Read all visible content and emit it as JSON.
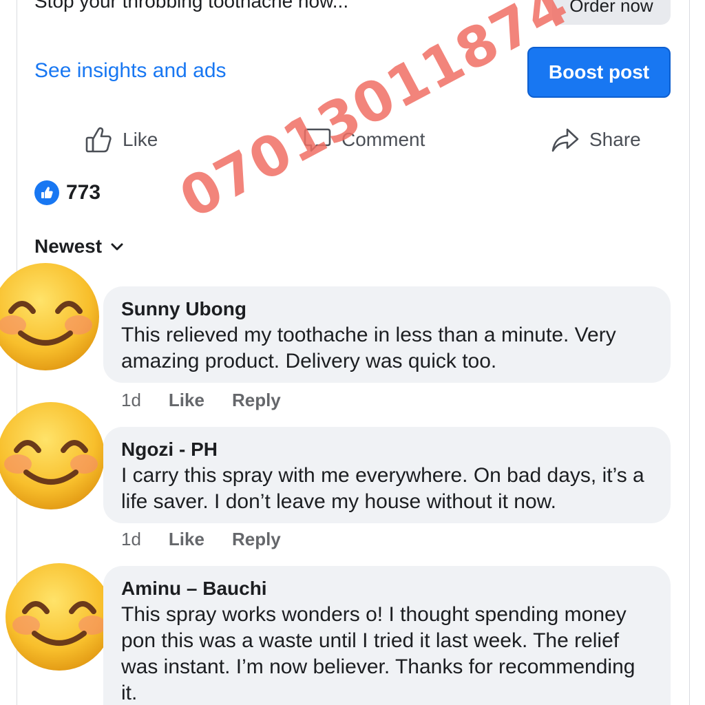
{
  "post": {
    "ad_caption": "Stop your throbbing toothache now...",
    "order_button": "Order now",
    "insights_link": "See insights and ads",
    "boost_button": "Boost post"
  },
  "actions": {
    "like": "Like",
    "comment": "Comment",
    "share": "Share"
  },
  "reactions": {
    "count": "773"
  },
  "sort": {
    "label": "Newest"
  },
  "watermark": "07013011874",
  "comments": [
    {
      "name": "Sunny Ubong",
      "text": "This relieved my toothache in less than a minute. Very amazing product. Delivery was quick too.",
      "time": "1d",
      "like": "Like",
      "reply": "Reply"
    },
    {
      "name": "Ngozi - PH",
      "text": "I carry this spray with me everywhere. On bad days, it’s a life saver. I don’t leave my house without it now.",
      "time": "1d",
      "like": "Like",
      "reply": "Reply"
    },
    {
      "name": "Aminu – Bauchi",
      "text": "This spray works wonders o! I thought spending money pon this was a waste until I tried it last week. The relief was instant. I’m now believer. Thanks for recommending it.",
      "time": "",
      "like": "",
      "reply": ""
    }
  ],
  "colors": {
    "accent": "#1877f2",
    "bubble": "#f0f2f5",
    "watermark": "#f06e64"
  },
  "icons": {
    "like": "thumbs-up-icon",
    "comment": "speech-bubble-icon",
    "share": "share-arrow-icon",
    "sort": "chevron-down-icon",
    "avatar": "smiling-face-emoji-icon"
  }
}
